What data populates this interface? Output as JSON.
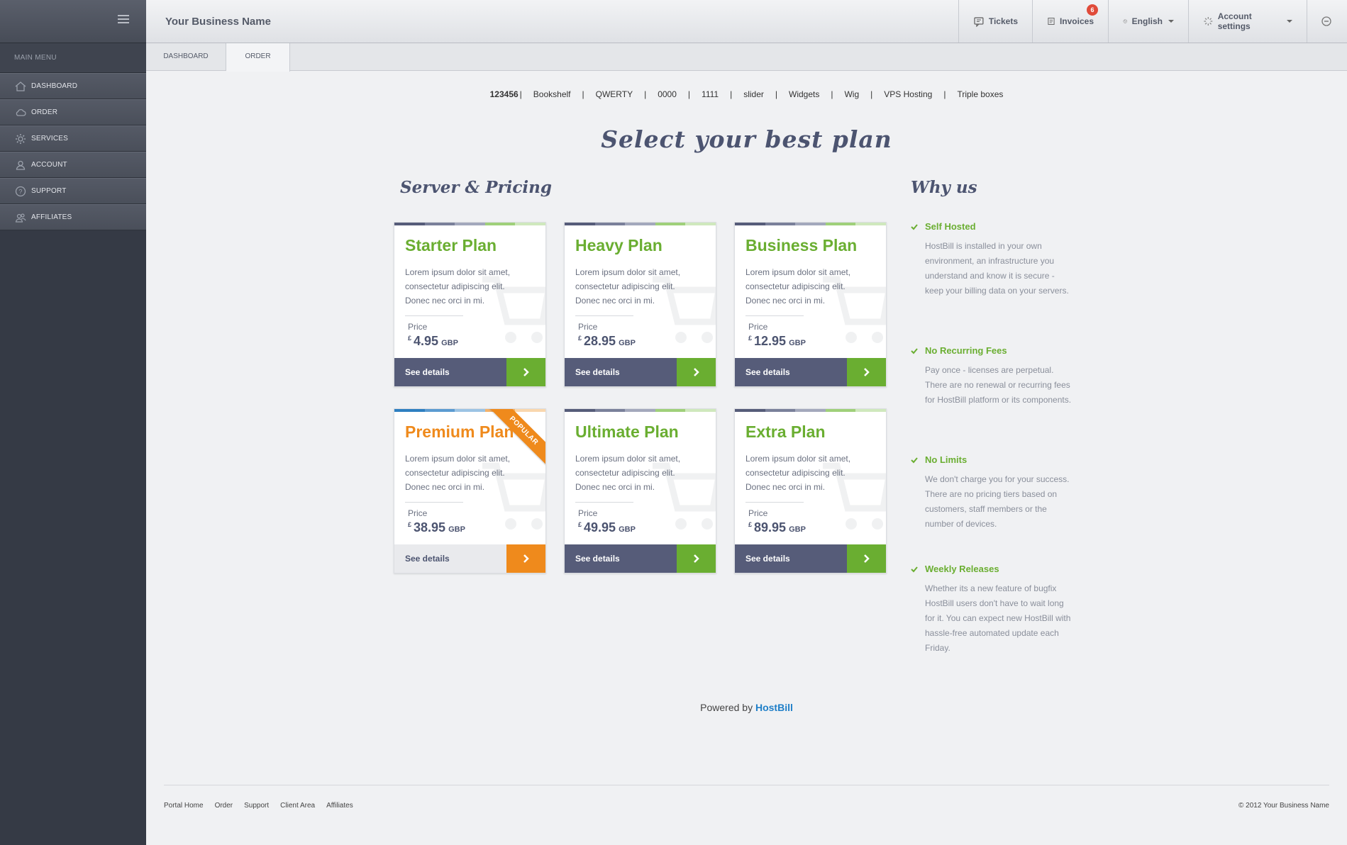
{
  "sidebar": {
    "menu_heading": "MAIN MENU",
    "items": [
      {
        "label": "DASHBOARD",
        "icon": "home-icon"
      },
      {
        "label": "ORDER",
        "icon": "cloud-icon"
      },
      {
        "label": "SERVICES",
        "icon": "gear-icon"
      },
      {
        "label": "ACCOUNT",
        "icon": "user-icon"
      },
      {
        "label": "SUPPORT",
        "icon": "question-icon"
      },
      {
        "label": "AFFILIATES",
        "icon": "users-icon"
      }
    ]
  },
  "header": {
    "brand": "Your Business Name",
    "tickets_label": "Tickets",
    "invoices_label": "Invoices",
    "invoices_badge": "6",
    "language_label": "English",
    "account_label": "Account settings"
  },
  "tabs": [
    {
      "label": "DASHBOARD",
      "active": false
    },
    {
      "label": "ORDER",
      "active": true
    }
  ],
  "categories": [
    {
      "label": "123456",
      "active": true
    },
    {
      "label": "Bookshelf"
    },
    {
      "label": "QWERTY"
    },
    {
      "label": "0000"
    },
    {
      "label": "1111"
    },
    {
      "label": "slider"
    },
    {
      "label": "Widgets"
    },
    {
      "label": "Wig"
    },
    {
      "label": "VPS Hosting"
    },
    {
      "label": "Triple boxes"
    }
  ],
  "titles": {
    "main": "Select your best plan",
    "pricing": "Server & Pricing",
    "why": "Why us"
  },
  "plans": [
    {
      "name": "Starter Plan",
      "desc": "Lorem ipsum dolor sit amet, consectetur adipiscing elit. Donec nec orci in mi.",
      "price_label": "Price",
      "currency_symbol": "£",
      "price": "4.95",
      "currency_code": "GBP",
      "cta": "See details",
      "popular": false
    },
    {
      "name": "Heavy Plan",
      "desc": "Lorem ipsum dolor sit amet, consectetur adipiscing elit. Donec nec orci in mi.",
      "price_label": "Price",
      "currency_symbol": "£",
      "price": "28.95",
      "currency_code": "GBP",
      "cta": "See details",
      "popular": false
    },
    {
      "name": "Business Plan",
      "desc": "Lorem ipsum dolor sit amet, consectetur adipiscing elit. Donec nec orci in mi.",
      "price_label": "Price",
      "currency_symbol": "£",
      "price": "12.95",
      "currency_code": "GBP",
      "cta": "See details",
      "popular": false
    },
    {
      "name": "Premium Plan",
      "desc": "Lorem ipsum dolor sit amet, consectetur adipiscing elit. Donec nec orci in mi.",
      "price_label": "Price",
      "currency_symbol": "£",
      "price": "38.95",
      "currency_code": "GBP",
      "cta": "See details",
      "popular": true,
      "ribbon": "POPULAR"
    },
    {
      "name": "Ultimate Plan",
      "desc": "Lorem ipsum dolor sit amet, consectetur adipiscing elit. Donec nec orci in mi.",
      "price_label": "Price",
      "currency_symbol": "£",
      "price": "49.95",
      "currency_code": "GBP",
      "cta": "See details",
      "popular": false
    },
    {
      "name": "Extra Plan",
      "desc": "Lorem ipsum dolor sit amet, consectetur adipiscing elit. Donec nec orci in mi.",
      "price_label": "Price",
      "currency_symbol": "£",
      "price": "89.95",
      "currency_code": "GBP",
      "cta": "See details",
      "popular": false
    }
  ],
  "why": [
    {
      "title": "Self Hosted",
      "text": "HostBill is installed in your own environment, an infrastructure you understand and know it is secure - keep your billing data on your servers."
    },
    {
      "title": "No Recurring Fees",
      "text": "Pay once - licenses are perpetual. There are no renewal or recurring fees for HostBill platform or its components."
    },
    {
      "title": "No Limits",
      "text": "We don't charge you for your success. There are no pricing tiers based on customers, staff members or the number of devices."
    },
    {
      "title": "Weekly Releases",
      "text": "Whether its a new feature of bugfix HostBill users don't have to wait long for it. You can expect new HostBill with hassle-free automated update each Friday."
    }
  ],
  "powered": {
    "prefix": "Powered by",
    "brand": "HostBill"
  },
  "footer": {
    "links": [
      "Portal Home",
      "Order",
      "Support",
      "Client Area",
      "Affiliates"
    ],
    "copyright": "© 2012 Your Business Name"
  },
  "colors": {
    "accent_green": "#6aae31",
    "accent_orange": "#ef8a1c",
    "navy": "#565c79",
    "link_blue": "#1f7fc8"
  }
}
